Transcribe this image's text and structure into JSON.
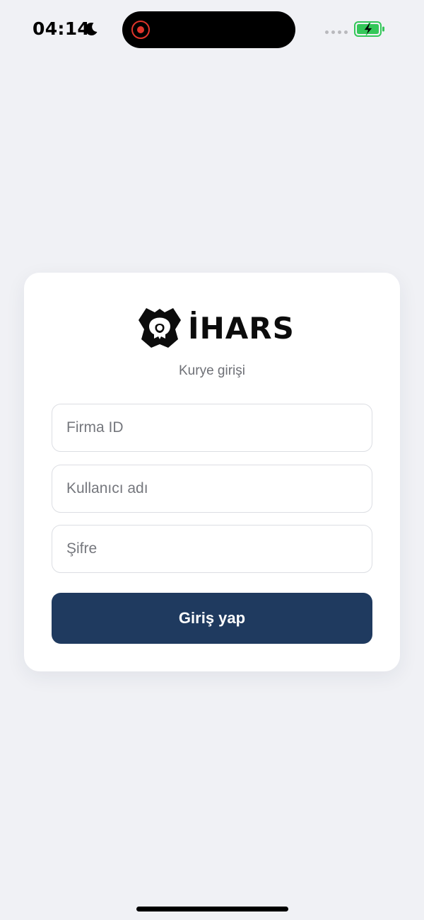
{
  "status_bar": {
    "time": "04:14",
    "icons": [
      "moon-icon",
      "screen-record-icon",
      "signal-icon",
      "battery-charging-icon"
    ],
    "battery_color": "#34c759",
    "record_color": "#e0352b"
  },
  "login": {
    "logo_text": "İHARS",
    "logo_icon": "ihars-emblem-icon",
    "subtitle": "Kurye girişi",
    "fields": {
      "firma_id": {
        "placeholder": "Firma ID",
        "value": ""
      },
      "username": {
        "placeholder": "Kullanıcı adı",
        "value": ""
      },
      "password": {
        "placeholder": "Şifre",
        "value": ""
      }
    },
    "submit_label": "Giriş yap"
  },
  "colors": {
    "background": "#f0f1f5",
    "card": "#ffffff",
    "primary_button": "#1f3a5f",
    "subtitle_text": "#6e7076"
  }
}
